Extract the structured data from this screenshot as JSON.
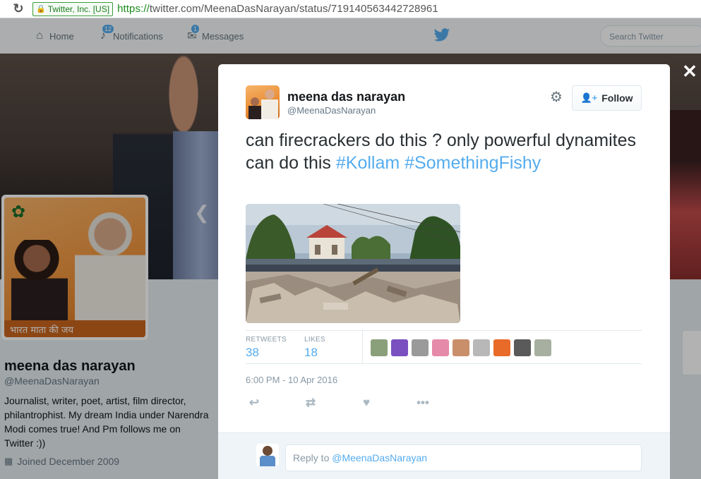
{
  "browser": {
    "reload_icon": "reload-icon",
    "ssl_label": "Twitter, Inc. [US]",
    "url_protocol": "https://",
    "url_rest": "twitter.com/MeenaDasNarayan/status/719140563442728961"
  },
  "topnav": {
    "home_label": "Home",
    "notifications_label": "Notifications",
    "notifications_count": "12",
    "messages_label": "Messages",
    "messages_count": "1",
    "search_placeholder": "Search Twitter"
  },
  "profile": {
    "name": "meena das narayan",
    "handle": "@MeenaDasNarayan",
    "bio": "Journalist, writer, poet, artist, film director, philantrophist. My dream India under Narendra Modi comes true! And Pm follows me on Twitter :))",
    "joined": "Joined December 2009",
    "avatar_banner": "भारत माता की जय"
  },
  "tweet": {
    "author_name": "meena das narayan",
    "author_handle": "@MeenaDasNarayan",
    "follow_label": "Follow",
    "text_plain": "can firecrackers do this ? only powerful dynamites can do this ",
    "hashtag1": "#Kollam",
    "hashtag2": "#SomethingFishy",
    "retweets_label": "RETWEETS",
    "retweets_count": "38",
    "likes_label": "LIKES",
    "likes_count": "18",
    "timestamp": "6:00 PM - 10 Apr 2016",
    "likers": [
      {
        "color": "#8aa07a"
      },
      {
        "color": "#7a4fbf"
      },
      {
        "color": "#9a9a9a"
      },
      {
        "color": "#e58aa8"
      },
      {
        "color": "#c98f6a"
      },
      {
        "color": "#b8b8b8"
      },
      {
        "color": "#e86b2a"
      },
      {
        "color": "#5a5a5a"
      },
      {
        "color": "#a7b0a0"
      }
    ]
  },
  "reply": {
    "prefix": "Reply to ",
    "mention": "@MeenaDasNarayan"
  },
  "colors": {
    "twitter_blue": "#55acee",
    "ssl_green": "#1a8c1a"
  }
}
